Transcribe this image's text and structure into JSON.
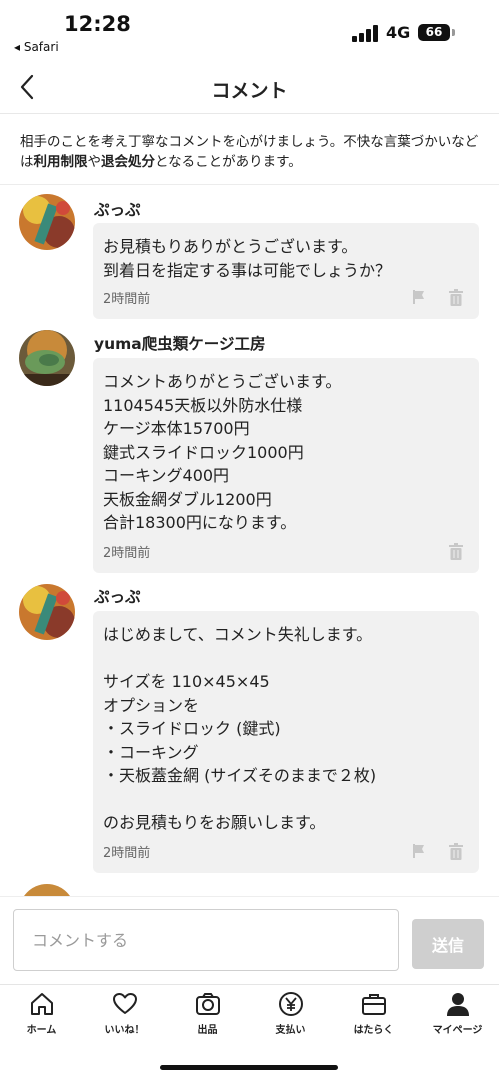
{
  "status_bar": {
    "time": "12:28",
    "back_app": "◂ Safari",
    "network": "4G",
    "battery": "66"
  },
  "header": {
    "title": "コメント"
  },
  "notice": {
    "part1": "相手のことを考え丁寧なコメントを心がけましょう。不快な言葉づかいなどは",
    "bold1": "利用制限",
    "part2": "や",
    "bold2": "退会処分",
    "part3": "となることがあります。"
  },
  "comments": [
    {
      "author": "ぷっぷ",
      "text": "お見積もりありがとうございます。\n到着日を指定する事は可能でしょうか？",
      "time": "2時間前",
      "has_flag": true
    },
    {
      "author": "yuma爬虫類ケージ工房",
      "text": "コメントありがとうございます。\n1104545天板以外防水仕様\nケージ本体15700円\n鍵式スライドロック1000円\nコーキング400円\n天板金網ダブル1200円\n合計18300円になります。",
      "time": "2時間前",
      "has_flag": false
    },
    {
      "author": "ぷっぷ",
      "text": "はじめまして、コメント失礼します。\n\nサイズを 110×45×45\nオプションを\n・スライドロック (鍵式)\n・コーキング\n・天板蓋金網 (サイズそのままで２枚)\n\nのお見積もりをお願いします。",
      "time": "2時間前",
      "has_flag": true
    }
  ],
  "input": {
    "placeholder": "コメントする",
    "send_label": "送信"
  },
  "bottom_nav": [
    {
      "label": "ホーム",
      "icon": "home-icon"
    },
    {
      "label": "いいね！",
      "icon": "heart-icon"
    },
    {
      "label": "出品",
      "icon": "camera-icon"
    },
    {
      "label": "支払い",
      "icon": "yen-icon"
    },
    {
      "label": "はたらく",
      "icon": "briefcase-icon"
    },
    {
      "label": "マイページ",
      "icon": "person-icon"
    }
  ],
  "colors": {
    "bubble_bg": "#f1f1f1",
    "send_disabled": "#cfcfcf",
    "text": "#222222"
  }
}
